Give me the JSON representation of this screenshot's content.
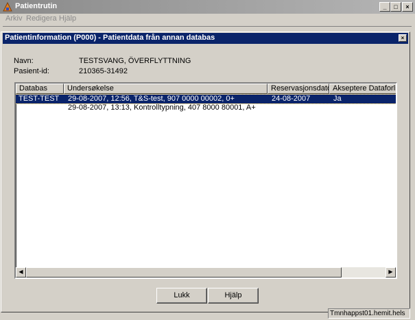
{
  "app": {
    "title": "Patientrutin",
    "menu": [
      "Arkiv",
      "Redigera",
      "Hjälp"
    ],
    "window_buttons": [
      "_",
      "□",
      "×"
    ],
    "status": "Tmnhappst01.hemit.hels"
  },
  "dialog": {
    "title": "Patientinformation (P000) - Patientdata från annan databas",
    "close_label": "×",
    "name_label": "Navn:",
    "name_value": "TESTSVANG, ÖVERFLYTTNING",
    "id_label": "Pasient-id:",
    "id_value": "210365-31492",
    "table": {
      "columns": [
        "Databas",
        "Undersøkelse",
        "Reservasjonsdato",
        "Akseptere Dataforlik"
      ],
      "rows": [
        {
          "databas": "TEST-TEST",
          "undersokelse": "29-08-2007, 12:56, T&S-test, 907 0000 00002, 0+",
          "dato": "24-08-2007",
          "akseptere": "Ja",
          "selected": true
        },
        {
          "databas": "",
          "undersokelse": "29-08-2007, 13:13, Kontrolltypning, 407 8000 80001, A+",
          "dato": "",
          "akseptere": "",
          "selected": false
        }
      ]
    },
    "buttons": {
      "close": "Lukk",
      "help": "Hjälp"
    }
  },
  "colors": {
    "title_active": "#0a246a",
    "title_inactive": "#8a8a8a",
    "face": "#d4d0c8",
    "highlight_text": "#ffffff"
  }
}
